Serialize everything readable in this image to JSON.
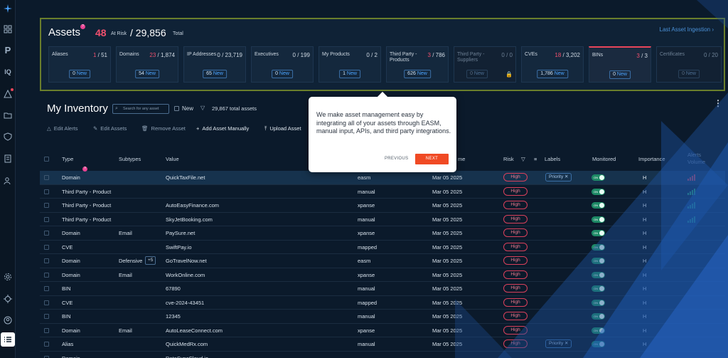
{
  "assets": {
    "title": "Assets",
    "at_risk_count": "48",
    "at_risk_label": "At Risk",
    "total": "/ 29,856",
    "total_label": "Total",
    "last_ingestion": "Last Asset Ingestion ›",
    "cards": [
      {
        "name": "Aliases",
        "risk": "1",
        "count": "/ 51",
        "new_count": "0",
        "new_label": "New"
      },
      {
        "name": "Domains",
        "risk": "23",
        "count": "/ 1,874",
        "new_count": "54",
        "new_label": "New"
      },
      {
        "name": "IP Addresses",
        "risk": "0",
        "count": "/ 23,719",
        "new_count": "65",
        "new_label": "New"
      },
      {
        "name": "Executives",
        "risk": "0",
        "count": "/ 199",
        "new_count": "0",
        "new_label": "New"
      },
      {
        "name": "My Products",
        "risk": "0",
        "count": "/ 2",
        "new_count": "1",
        "new_label": "New"
      },
      {
        "name": "Third Party - Products",
        "risk": "3",
        "count": "/ 786",
        "new_count": "626",
        "new_label": "New"
      },
      {
        "name": "Third Party - Suppliers",
        "risk": "0",
        "count": "/ 0",
        "new_count": "0",
        "new_label": "New"
      },
      {
        "name": "CVEs",
        "risk": "18",
        "count": "/ 3,202",
        "new_count": "1,786",
        "new_label": "New"
      },
      {
        "name": "BINs",
        "risk": "3",
        "count": "/ 3",
        "new_count": "0",
        "new_label": "New"
      },
      {
        "name": "Certificates",
        "risk": "0",
        "count": "/ 20",
        "new_count": "0",
        "new_label": "New"
      }
    ]
  },
  "inventory": {
    "title": "My Inventory",
    "search_placeholder": "Search for any asset",
    "new_filter_label": "New",
    "total_assets": "29,867 total assets"
  },
  "actions": {
    "edit_alerts": "Edit Alerts",
    "edit_assets": "Edit Assets",
    "remove_asset": "Remove Asset",
    "add_manually": "Add Asset Manually",
    "upload_asset": "Upload Asset"
  },
  "table": {
    "headers": {
      "type": "Type",
      "subtypes": "Subtypes",
      "value": "Value",
      "date": "me",
      "risk": "Risk",
      "labels": "Labels",
      "monitored": "Monitored",
      "importance": "Importance",
      "alerts_volume": "Alerts Volume"
    },
    "rows": [
      {
        "type": "Domain",
        "subtype": "",
        "value": "QuickTaxFile.net",
        "source": "easm",
        "date": "Mar 05 2025",
        "risk": "High",
        "label": "Priority ✕",
        "monitored": "ON",
        "importance": "H"
      },
      {
        "type": "Third Party - Product",
        "subtype": "",
        "value": "",
        "source": "manual",
        "date": "Mar 05 2025",
        "risk": "High",
        "label": "",
        "monitored": "ON",
        "importance": "H"
      },
      {
        "type": "Third Party - Product",
        "subtype": "",
        "value": "AutoEasyFinance.com",
        "source": "xpanse",
        "date": "Mar 05 2025",
        "risk": "High",
        "label": "",
        "monitored": "ON",
        "importance": "H"
      },
      {
        "type": "Third Party - Product",
        "subtype": "",
        "value": "SkyJetBooking.com",
        "source": "manual",
        "date": "Mar 05 2025",
        "risk": "High",
        "label": "",
        "monitored": "ON",
        "importance": "H"
      },
      {
        "type": "Domain",
        "subtype": "Email",
        "value": "PaySure.net",
        "source": "xpanse",
        "date": "Mar 05 2025",
        "risk": "High",
        "label": "",
        "monitored": "ON",
        "importance": "H"
      },
      {
        "type": "CVE",
        "subtype": "",
        "value": "SwiftPay.io",
        "source": "mapped",
        "date": "Mar 05 2025",
        "risk": "High",
        "label": "",
        "monitored": "ON",
        "importance": "H"
      },
      {
        "type": "Domain",
        "subtype": "Defensive",
        "value": "GoTravelNow.net",
        "source": "easm",
        "date": "Mar 05 2025",
        "risk": "High",
        "label": "",
        "monitored": "ON",
        "importance": "H",
        "extra": "+5"
      },
      {
        "type": "Domain",
        "subtype": "Email",
        "value": "WorkOnline.com",
        "source": "xpanse",
        "date": "Mar 05 2025",
        "risk": "High",
        "label": "",
        "monitored": "ON",
        "importance": "H"
      },
      {
        "type": "BIN",
        "subtype": "",
        "value": "67890",
        "source": "manual",
        "date": "Mar 05 2025",
        "risk": "High",
        "label": "",
        "monitored": "ON",
        "importance": "H"
      },
      {
        "type": "CVE",
        "subtype": "",
        "value": "cve-2024-43451",
        "source": "mapped",
        "date": "Mar 05 2025",
        "risk": "High",
        "label": "",
        "monitored": "ON",
        "importance": "H"
      },
      {
        "type": "BIN",
        "subtype": "",
        "value": "12345",
        "source": "manual",
        "date": "Mar 05 2025",
        "risk": "High",
        "label": "",
        "monitored": "ON",
        "importance": "H"
      },
      {
        "type": "Domain",
        "subtype": "Email",
        "value": "AutoLeaseConnect.com",
        "source": "xpanse",
        "date": "Mar 05 2025",
        "risk": "High",
        "label": "",
        "monitored": "ON",
        "importance": "H"
      },
      {
        "type": "Alias",
        "subtype": "",
        "value": "QuickMedRx.com",
        "source": "manual",
        "date": "Mar 05 2025",
        "risk": "High",
        "label": "Priority ✕",
        "monitored": "ON",
        "importance": "H"
      },
      {
        "type": "Domain",
        "subtype": "",
        "value": "DataSyncCloud.io",
        "source": "",
        "date": "",
        "risk": "",
        "label": "",
        "monitored": "",
        "importance": ""
      }
    ]
  },
  "tooltip": {
    "text": "We make asset management easy by integrating all of your assets through EASM, manual input, APIs, and third party integrations.",
    "previous": "PREVIOUS",
    "next": "NEXT"
  },
  "sidebar": {
    "iq_label": "IQ"
  },
  "colors": {
    "background": "#0b1a2b",
    "risk_red": "#f0506e",
    "accent_blue": "#4aa3ff",
    "next_orange": "#f04a24",
    "panel_highlight": "#6a7e2c"
  }
}
